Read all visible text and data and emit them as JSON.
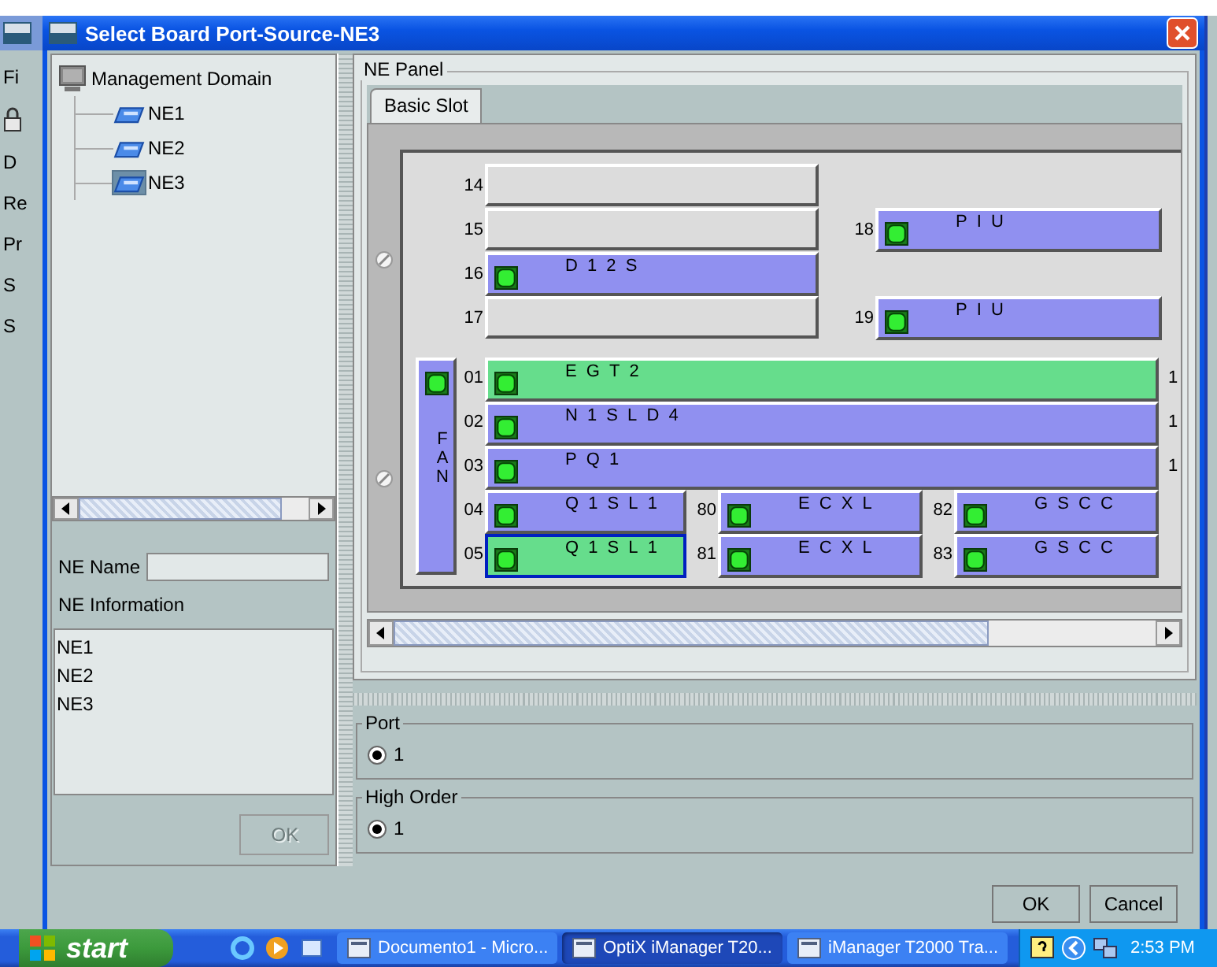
{
  "background_app": {
    "labels": [
      "Fi",
      "D",
      "Re",
      "Pr",
      "S",
      "S"
    ]
  },
  "window": {
    "title": "Select Board Port-Source-NE3"
  },
  "tree": {
    "label": "Management Domain",
    "children": [
      {
        "label": "NE1",
        "selected": false
      },
      {
        "label": "NE2",
        "selected": false
      },
      {
        "label": "NE3",
        "selected": true
      }
    ]
  },
  "ne_name": {
    "label": "NE Name"
  },
  "ne_information": {
    "label": "NE Information",
    "items": [
      "NE1",
      "NE2",
      "NE3"
    ]
  },
  "left_ok": {
    "label": "OK",
    "disabled": true
  },
  "ne_panel": {
    "title": "NE Panel",
    "tabs": [
      {
        "label": "Basic Slot",
        "selected": true
      }
    ],
    "upper_left": [
      {
        "number": "14",
        "kind": "empty",
        "selected": false
      },
      {
        "number": "15",
        "kind": "empty",
        "selected": false
      },
      {
        "number": "16",
        "kind": "board",
        "board": "D12S",
        "color": "#9090f0",
        "selected": false
      },
      {
        "number": "17",
        "kind": "empty",
        "selected": false
      }
    ],
    "upper_right": [
      {
        "number": "18",
        "kind": "board",
        "board": "PIU",
        "color": "#9090f0",
        "selected": false
      },
      {
        "number": "19",
        "kind": "board",
        "board": "PIU",
        "color": "#9090f0",
        "selected": false
      }
    ],
    "fan": {
      "label": "FAN",
      "color": "#9090f0"
    },
    "lower_wide": [
      {
        "number": "01",
        "kind": "board",
        "board": "EGT2",
        "color": "#66dd8c",
        "selected": false,
        "edge": "1"
      },
      {
        "number": "02",
        "kind": "board",
        "board": "N1SLD4",
        "color": "#9090f0",
        "selected": false,
        "edge": "1"
      },
      {
        "number": "03",
        "kind": "board",
        "board": "PQ1",
        "color": "#9090f0",
        "selected": false,
        "edge": "1"
      }
    ],
    "lower_split": [
      {
        "cells": [
          {
            "number": "04",
            "kind": "board",
            "board": "Q1SL1",
            "color": "#9090f0",
            "selected": false
          },
          {
            "number": "80",
            "kind": "board",
            "board": "ECXL",
            "color": "#9090f0",
            "selected": false
          },
          {
            "number": "82",
            "kind": "board",
            "board": "GSCC",
            "color": "#9090f0",
            "selected": false
          }
        ]
      },
      {
        "cells": [
          {
            "number": "05",
            "kind": "board",
            "board": "Q1SL1",
            "color": "#66dd8c",
            "selected": true
          },
          {
            "number": "81",
            "kind": "board",
            "board": "ECXL",
            "color": "#9090f0",
            "selected": false
          },
          {
            "number": "83",
            "kind": "board",
            "board": "GSCC",
            "color": "#9090f0",
            "selected": false
          }
        ]
      }
    ]
  },
  "port": {
    "title": "Port",
    "options": [
      {
        "label": "1",
        "selected": true
      }
    ]
  },
  "high_order": {
    "title": "High Order",
    "options": [
      {
        "label": "1",
        "selected": true
      }
    ]
  },
  "buttons": [
    {
      "label": "OK"
    },
    {
      "label": "Cancel"
    }
  ],
  "taskbar": {
    "start": "start",
    "tasks": [
      {
        "label": "Documento1 - Micro...",
        "selected": false
      },
      {
        "label": "OptiX iManager T20...",
        "selected": true
      },
      {
        "label": "iManager T2000 Tra...",
        "selected": false
      }
    ],
    "clock": "2:53 PM"
  }
}
